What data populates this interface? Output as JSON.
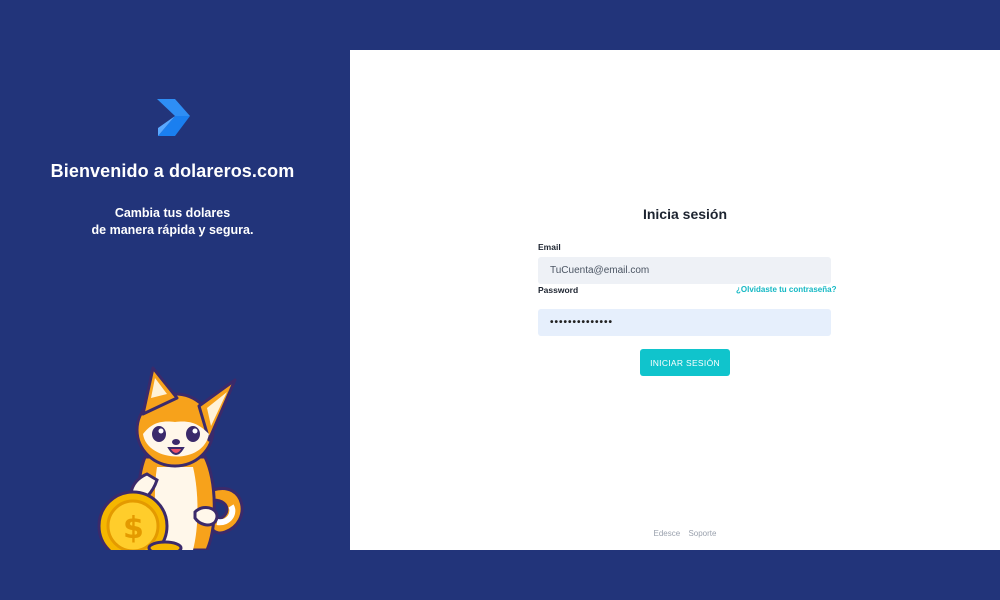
{
  "colors": {
    "background": "#22347a",
    "card": "#ffffff",
    "accent": "#10c4cc",
    "logo_blue": "#2e8ef5"
  },
  "sidebar": {
    "welcome": "Bienvenido a dolareros.com",
    "tagline_line1": "Cambia tus dolares",
    "tagline_line2": "de manera rápida y segura."
  },
  "login": {
    "title": "Inicia sesión",
    "email_label": "Email",
    "email_value": "TuCuenta@email.com",
    "password_label": "Password",
    "password_value": "••••••••••••••",
    "forgot_link": "¿Olvidaste tu contraseña?",
    "submit_label": "INICIAR SESIÓN"
  },
  "footer": {
    "link1": "Edesce",
    "link2": "Soporte"
  }
}
